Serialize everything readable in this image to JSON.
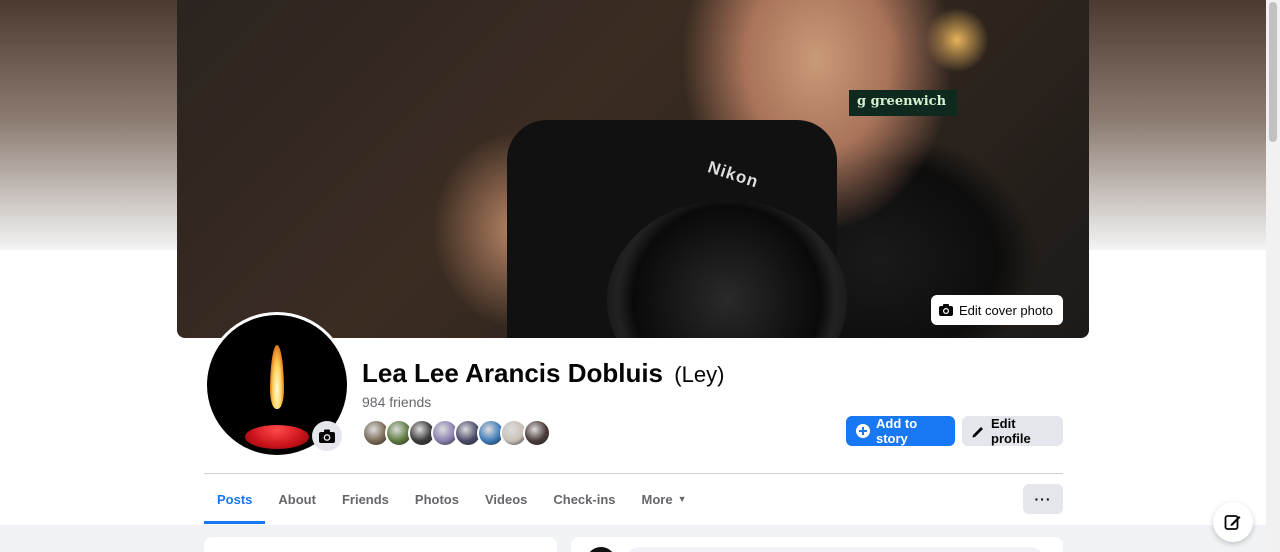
{
  "cover": {
    "edit_label": "Edit cover photo",
    "sign_text": "g greenwich",
    "camera_brand": "Nikon"
  },
  "profile": {
    "name": "Lea Lee Arancis Dobluis",
    "alternate_name": "(Ley)",
    "friend_count": "984 friends",
    "friend_avatars": [
      "#7a6a55",
      "#5d7a3e",
      "#3a3a3a",
      "#8a7fb0",
      "#4a4a6a",
      "#3d7ab8",
      "#c9c0b8",
      "#4a3a38"
    ]
  },
  "actions": {
    "add_to_story": "Add to story",
    "edit_profile": "Edit profile"
  },
  "tabs": [
    {
      "label": "Posts",
      "active": true
    },
    {
      "label": "About"
    },
    {
      "label": "Friends"
    },
    {
      "label": "Photos"
    },
    {
      "label": "Videos"
    },
    {
      "label": "Check-ins"
    },
    {
      "label": "More"
    }
  ],
  "more_menu_label": "···",
  "colors": {
    "accent": "#1877f2",
    "secondary_button": "#e4e6eb",
    "page_background": "#f0f2f5",
    "muted_text": "#65676b"
  },
  "icons": {
    "camera": "camera-icon",
    "plus": "plus-circle-icon",
    "pencil": "pencil-icon",
    "caret": "caret-down-icon",
    "compose": "compose-icon"
  }
}
